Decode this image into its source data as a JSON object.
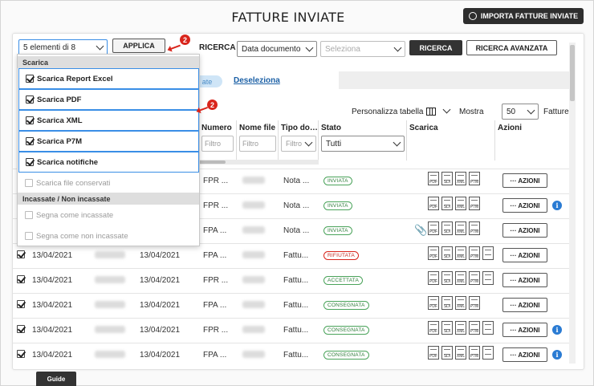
{
  "title": "FATTURE INVIATE",
  "import_button": "IMPORTA FATTURE INVIATE",
  "bulk": {
    "select_value": "5 elementi di 8",
    "apply_label": "APPLICA",
    "step_badge": "2"
  },
  "search": {
    "label": "RICERCA",
    "date_select": "Data documento",
    "range_placeholder": "Seleziona",
    "search_button": "RICERCA",
    "advanced_button": "RICERCA AVANZATA"
  },
  "selection": {
    "select_pill": "ate",
    "deselect_link": "Deseleziona"
  },
  "dropdown": {
    "section_download": "Scarica",
    "items": [
      "Scarica Report Excel",
      "Scarica PDF",
      "Scarica XML",
      "Scarica P7M",
      "Scarica notifiche"
    ],
    "disabled_download": "Scarica file conservati",
    "section_paid": "Incassate / Non incassate",
    "mark_paid": "Segna come incassate",
    "mark_unpaid": "Segna come non incassate",
    "step_badge": "2"
  },
  "table_tools": {
    "customize": "Personalizza tabella",
    "show": "Mostra",
    "page_size": "50",
    "unit": "Fatture"
  },
  "columns": {
    "numero": "Numero",
    "nome_file": "Nome file",
    "tipo_doc": "Tipo do…",
    "stato": "Stato",
    "scarica": "Scarica",
    "azioni": "Azioni"
  },
  "filters": {
    "placeholder": "Filtro",
    "stato_value": "Tutti"
  },
  "file_icons": [
    "PDF",
    "SDI",
    "XML",
    "P7M"
  ],
  "actions_label": "··· AZIONI",
  "info_glyph": "i",
  "rows": [
    {
      "date": "",
      "date2": "",
      "numero": "FPR ...",
      "tipo": "Nota ...",
      "stato": "INVIATA",
      "stato_kind": "green",
      "clip": false,
      "extra_icon": false,
      "info": false
    },
    {
      "date": "",
      "date2": "",
      "numero": "FPR ...",
      "tipo": "Nota ...",
      "stato": "INVIATA",
      "stato_kind": "green",
      "clip": false,
      "extra_icon": false,
      "info": true
    },
    {
      "date": "",
      "date2": "",
      "numero": "FPA ...",
      "tipo": "Nota ...",
      "stato": "INVIATA",
      "stato_kind": "green",
      "clip": true,
      "extra_icon": false,
      "info": false
    },
    {
      "date": "13/04/2021",
      "date2": "13/04/2021",
      "numero": "FPA ...",
      "tipo": "Fattu...",
      "stato": "RIFIUTATA",
      "stato_kind": "red",
      "clip": false,
      "extra_icon": true,
      "info": false
    },
    {
      "date": "13/04/2021",
      "date2": "13/04/2021",
      "numero": "FPR ...",
      "tipo": "Fattu...",
      "stato": "ACCETTATA",
      "stato_kind": "green",
      "clip": false,
      "extra_icon": true,
      "info": false
    },
    {
      "date": "13/04/2021",
      "date2": "13/04/2021",
      "numero": "FPA ...",
      "tipo": "Fattu...",
      "stato": "CONSEGNATA",
      "stato_kind": "green",
      "clip": false,
      "extra_icon": false,
      "info": false
    },
    {
      "date": "13/04/2021",
      "date2": "13/04/2021",
      "numero": "FPR ...",
      "tipo": "Fattu...",
      "stato": "CONSEGNATA",
      "stato_kind": "green",
      "clip": false,
      "extra_icon": true,
      "info": true
    },
    {
      "date": "13/04/2021",
      "date2": "13/04/2021",
      "numero": "FPA ...",
      "tipo": "Fattu...",
      "stato": "CONSEGNATA",
      "stato_kind": "green",
      "clip": false,
      "extra_icon": true,
      "info": true
    }
  ],
  "guide_tab": "Guide",
  "colors": {
    "accent_red": "#d9251c",
    "link_blue": "#1a5fa5",
    "selection_border": "#3a8ee6",
    "status_green": "#2e7d3a",
    "status_red": "#c62820",
    "dark_button": "#333333"
  }
}
